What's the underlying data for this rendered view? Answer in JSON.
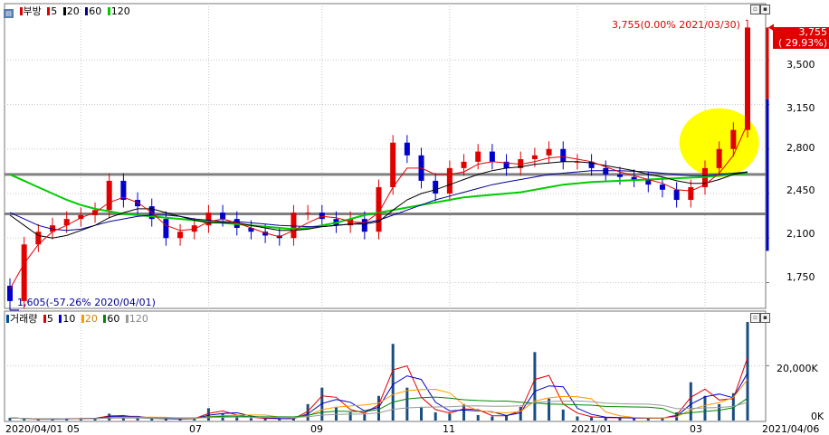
{
  "price_panel": {
    "stock_name": "부방",
    "ma_labels": [
      "5",
      "20",
      "60",
      "120"
    ],
    "y_ticks": [
      "3,500",
      "3,150",
      "2,800",
      "2,450",
      "2,100",
      "1,750"
    ],
    "max_annotation": "3,755(0.00% 2021/03/30)",
    "min_annotation": "1,605(-57.26% 2020/04/01)",
    "current_price": "3,755",
    "current_change": "( 29.93%)"
  },
  "volume_panel": {
    "title": "거래량",
    "ma_labels": [
      "5",
      "10",
      "20",
      "60",
      "120"
    ],
    "y_ticks": [
      "20,000K",
      "0K"
    ]
  },
  "x_axis": {
    "ticks": [
      "2020/04/01",
      "05",
      "07",
      "09",
      "11",
      "2021/01",
      "03"
    ],
    "end_label": "2021/04/06"
  },
  "colors": {
    "up": "#e10000",
    "down": "#0000cc",
    "ma5": "#e10000",
    "ma20": "#000000",
    "ma60": "#000099",
    "ma120": "#00cc00",
    "support_line": "#808080",
    "highlight": "#ffff00"
  },
  "chart_data": {
    "type": "candlestick",
    "price_range": [
      1590,
      3900
    ],
    "volume_range": [
      0,
      37000
    ],
    "dates": [
      "2020/04/01",
      "2020/04/08",
      "2020/04/15",
      "2020/04/22",
      "2020/04/29",
      "2020/05/06",
      "2020/05/13",
      "2020/05/20",
      "2020/05/27",
      "2020/06/03",
      "2020/06/10",
      "2020/06/17",
      "2020/06/24",
      "2020/07/01",
      "2020/07/08",
      "2020/07/15",
      "2020/07/22",
      "2020/07/29",
      "2020/08/05",
      "2020/08/12",
      "2020/08/19",
      "2020/08/26",
      "2020/09/02",
      "2020/09/09",
      "2020/09/16",
      "2020/09/23",
      "2020/09/30",
      "2020/10/07",
      "2020/10/14",
      "2020/10/21",
      "2020/10/28",
      "2020/11/04",
      "2020/11/11",
      "2020/11/18",
      "2020/11/25",
      "2020/12/02",
      "2020/12/09",
      "2020/12/16",
      "2020/12/23",
      "2020/12/30",
      "2021/01/06",
      "2021/01/13",
      "2021/01/20",
      "2021/01/27",
      "2021/02/03",
      "2021/02/10",
      "2021/02/17",
      "2021/02/24",
      "2021/03/03",
      "2021/03/10",
      "2021/03/17",
      "2021/03/24",
      "2021/03/30"
    ],
    "close": [
      1605,
      2050,
      2150,
      2200,
      2250,
      2280,
      2320,
      2550,
      2400,
      2350,
      2250,
      2100,
      2150,
      2200,
      2300,
      2250,
      2180,
      2150,
      2120,
      2100,
      2300,
      2300,
      2250,
      2200,
      2250,
      2150,
      2500,
      2850,
      2750,
      2550,
      2450,
      2650,
      2700,
      2780,
      2700,
      2650,
      2720,
      2750,
      2800,
      2700,
      2700,
      2650,
      2600,
      2580,
      2560,
      2520,
      2480,
      2400,
      2500,
      2650,
      2800,
      2950,
      3755
    ],
    "volume_k": [
      1000,
      500,
      400,
      600,
      800,
      700,
      900,
      2500,
      1200,
      900,
      700,
      600,
      600,
      700,
      4500,
      2500,
      1500,
      900,
      700,
      700,
      600,
      6000,
      12000,
      5000,
      3000,
      2500,
      9000,
      28000,
      12000,
      5000,
      3000,
      2500,
      6000,
      2000,
      1500,
      2000,
      5000,
      25000,
      8000,
      4000,
      1500,
      1200,
      1000,
      1000,
      900,
      800,
      900,
      3000,
      14000,
      9000,
      6000,
      10000,
      36000
    ],
    "ma5": [
      1700,
      1900,
      2050,
      2150,
      2200,
      2260,
      2300,
      2380,
      2420,
      2380,
      2300,
      2200,
      2160,
      2170,
      2230,
      2250,
      2220,
      2180,
      2140,
      2110,
      2160,
      2220,
      2270,
      2260,
      2230,
      2220,
      2300,
      2500,
      2650,
      2650,
      2600,
      2600,
      2620,
      2680,
      2700,
      2690,
      2680,
      2700,
      2730,
      2740,
      2720,
      2700,
      2660,
      2620,
      2590,
      2560,
      2530,
      2480,
      2470,
      2520,
      2610,
      2750,
      3000
    ],
    "ma20": [
      2280,
      2200,
      2120,
      2100,
      2120,
      2160,
      2200,
      2260,
      2300,
      2330,
      2330,
      2300,
      2270,
      2240,
      2220,
      2220,
      2220,
      2200,
      2180,
      2160,
      2160,
      2170,
      2190,
      2200,
      2210,
      2210,
      2230,
      2320,
      2400,
      2450,
      2480,
      2520,
      2560,
      2600,
      2630,
      2650,
      2660,
      2680,
      2690,
      2700,
      2700,
      2690,
      2670,
      2650,
      2630,
      2600,
      2580,
      2550,
      2530,
      2530,
      2560,
      2600,
      2620
    ],
    "ma60": [
      2300,
      2250,
      2200,
      2170,
      2160,
      2170,
      2200,
      2230,
      2250,
      2270,
      2280,
      2280,
      2270,
      2250,
      2240,
      2230,
      2230,
      2220,
      2210,
      2200,
      2195,
      2190,
      2190,
      2200,
      2210,
      2220,
      2240,
      2280,
      2320,
      2360,
      2400,
      2430,
      2460,
      2490,
      2520,
      2540,
      2560,
      2580,
      2600,
      2610,
      2620,
      2630,
      2630,
      2630,
      2625,
      2620,
      2610,
      2600,
      2590,
      2590,
      2600,
      2610,
      2620
    ],
    "ma120": [
      2600,
      2550,
      2500,
      2450,
      2400,
      2360,
      2330,
      2310,
      2290,
      2280,
      2270,
      2260,
      2250,
      2240,
      2230,
      2220,
      2210,
      2200,
      2190,
      2180,
      2170,
      2180,
      2200,
      2220,
      2250,
      2280,
      2300,
      2320,
      2340,
      2360,
      2380,
      2400,
      2420,
      2430,
      2440,
      2450,
      2460,
      2480,
      2500,
      2520,
      2530,
      2540,
      2545,
      2550,
      2555,
      2560,
      2565,
      2570,
      2575,
      2580,
      2590,
      2600,
      2610
    ],
    "support_levels": [
      2600,
      2290
    ]
  }
}
